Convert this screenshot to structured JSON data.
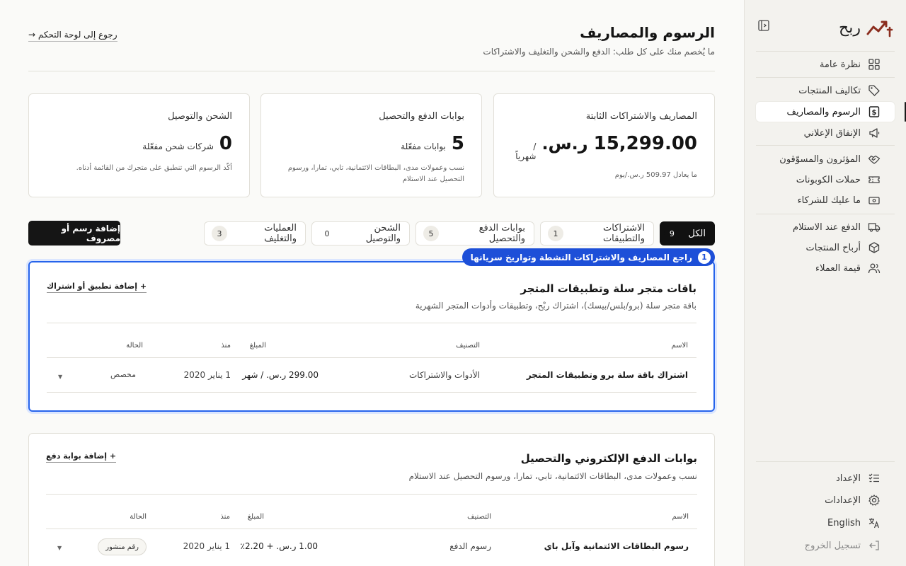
{
  "brand": {
    "name": "ربح"
  },
  "nav": {
    "overview": "نظرة عامة",
    "product_costs": "تكاليف المنتجات",
    "fees_expenses": "الرسوم والمصاريف",
    "ad_spend": "الإنفاق الإعلاني",
    "influencers": "المؤثرون والمسوّقون",
    "coupons": "حملات الكوبونات",
    "partners": "ما عليك للشركاء",
    "cod": "الدفع عند الاستلام",
    "product_profits": "أرباح المنتجات",
    "customer_value": "قيمة العملاء",
    "setup": "الإعداد",
    "settings": "الإعدادات",
    "language": "English",
    "logout": "تسجيل الخروج"
  },
  "header": {
    "title": "الرسوم والمصاريف",
    "subtitle": "ما يُخصم منك على كل طلب: الدفع والشحن والتغليف والاشتراكات",
    "back": "رجوع إلى لوحة التحكم →"
  },
  "stats": {
    "fixed": {
      "title": "المصاريف والاشتراكات الثابتة",
      "value": "15,299.00",
      "currency": "ر.س.",
      "unit": "/ شهرياً",
      "note": "ما يعادل 509.97 ر.س./يوم"
    },
    "payment": {
      "title": "بوابات الدفع والتحصيل",
      "value": "5",
      "unit": "بوابات مفعّلة",
      "note": "نسب وعمولات مدى، البطاقات الائتمانية، تابي، تمارا، ورسوم التحصيل عند الاستلام"
    },
    "shipping": {
      "title": "الشحن والتوصيل",
      "value": "0",
      "unit": "شركات شحن مفعّلة",
      "note": "أكّد الرسوم التي تنطبق على متجرك من القائمة أدناه."
    }
  },
  "tabs": [
    {
      "label": "الكل",
      "count": "9"
    },
    {
      "label": "الاشتراكات والتطبيقات",
      "count": "1"
    },
    {
      "label": "بوابات الدفع والتحصيل",
      "count": "5"
    },
    {
      "label": "الشحن والتوصيل",
      "count": "0"
    },
    {
      "label": "العمليات والتغليف",
      "count": "3"
    }
  ],
  "add_fee_button": "إضافة رسم أو مصروف",
  "callout": {
    "number": "1",
    "text": "راجع المصاريف والاشتراكات النشطة وتواريخ سريانها"
  },
  "sections": [
    {
      "title": "باقات متجر سلة وتطبيقات المتجر",
      "subtitle": "باقة متجر سلة (برو/بلس/بيسك)، اشتراك ربْح، وتطبيقات وأدوات المتجر الشهرية",
      "add": "+ إضافة تطبيق أو اشتراك",
      "columns": {
        "name": "الاسم",
        "category": "التصنيف",
        "amount": "المبلغ",
        "since": "منذ",
        "status": "الحالة"
      },
      "rows": [
        {
          "name": "اشتراك باقة سلة برو وتطبيقات المتجر",
          "category": "الأدوات والاشتراكات",
          "amount": "299.00 ر.س. / شهر",
          "since": "1 يناير 2020",
          "status": "مخصص"
        }
      ]
    },
    {
      "title": "بوابات الدفع الإلكتروني والتحصيل",
      "subtitle": "نسب وعمولات مدى، البطاقات الائتمانية، تابي، تمارا، ورسوم التحصيل عند الاستلام",
      "add": "+ إضافة بوابة دفع",
      "columns": {
        "name": "الاسم",
        "category": "التصنيف",
        "amount": "المبلغ",
        "since": "منذ",
        "status": "الحالة"
      },
      "rows": [
        {
          "name": "رسوم البطاقات الائتمانية وآبل باي",
          "category": "رسوم الدفع",
          "amount": "1.00 ر.س. + 2.20٪",
          "since": "1 يناير 2020",
          "status": "رقم منشور"
        }
      ]
    }
  ],
  "colors": {
    "accent": "#1d4fd8",
    "brand_icon": "#8b2e1f",
    "active_tab": "#111111"
  }
}
